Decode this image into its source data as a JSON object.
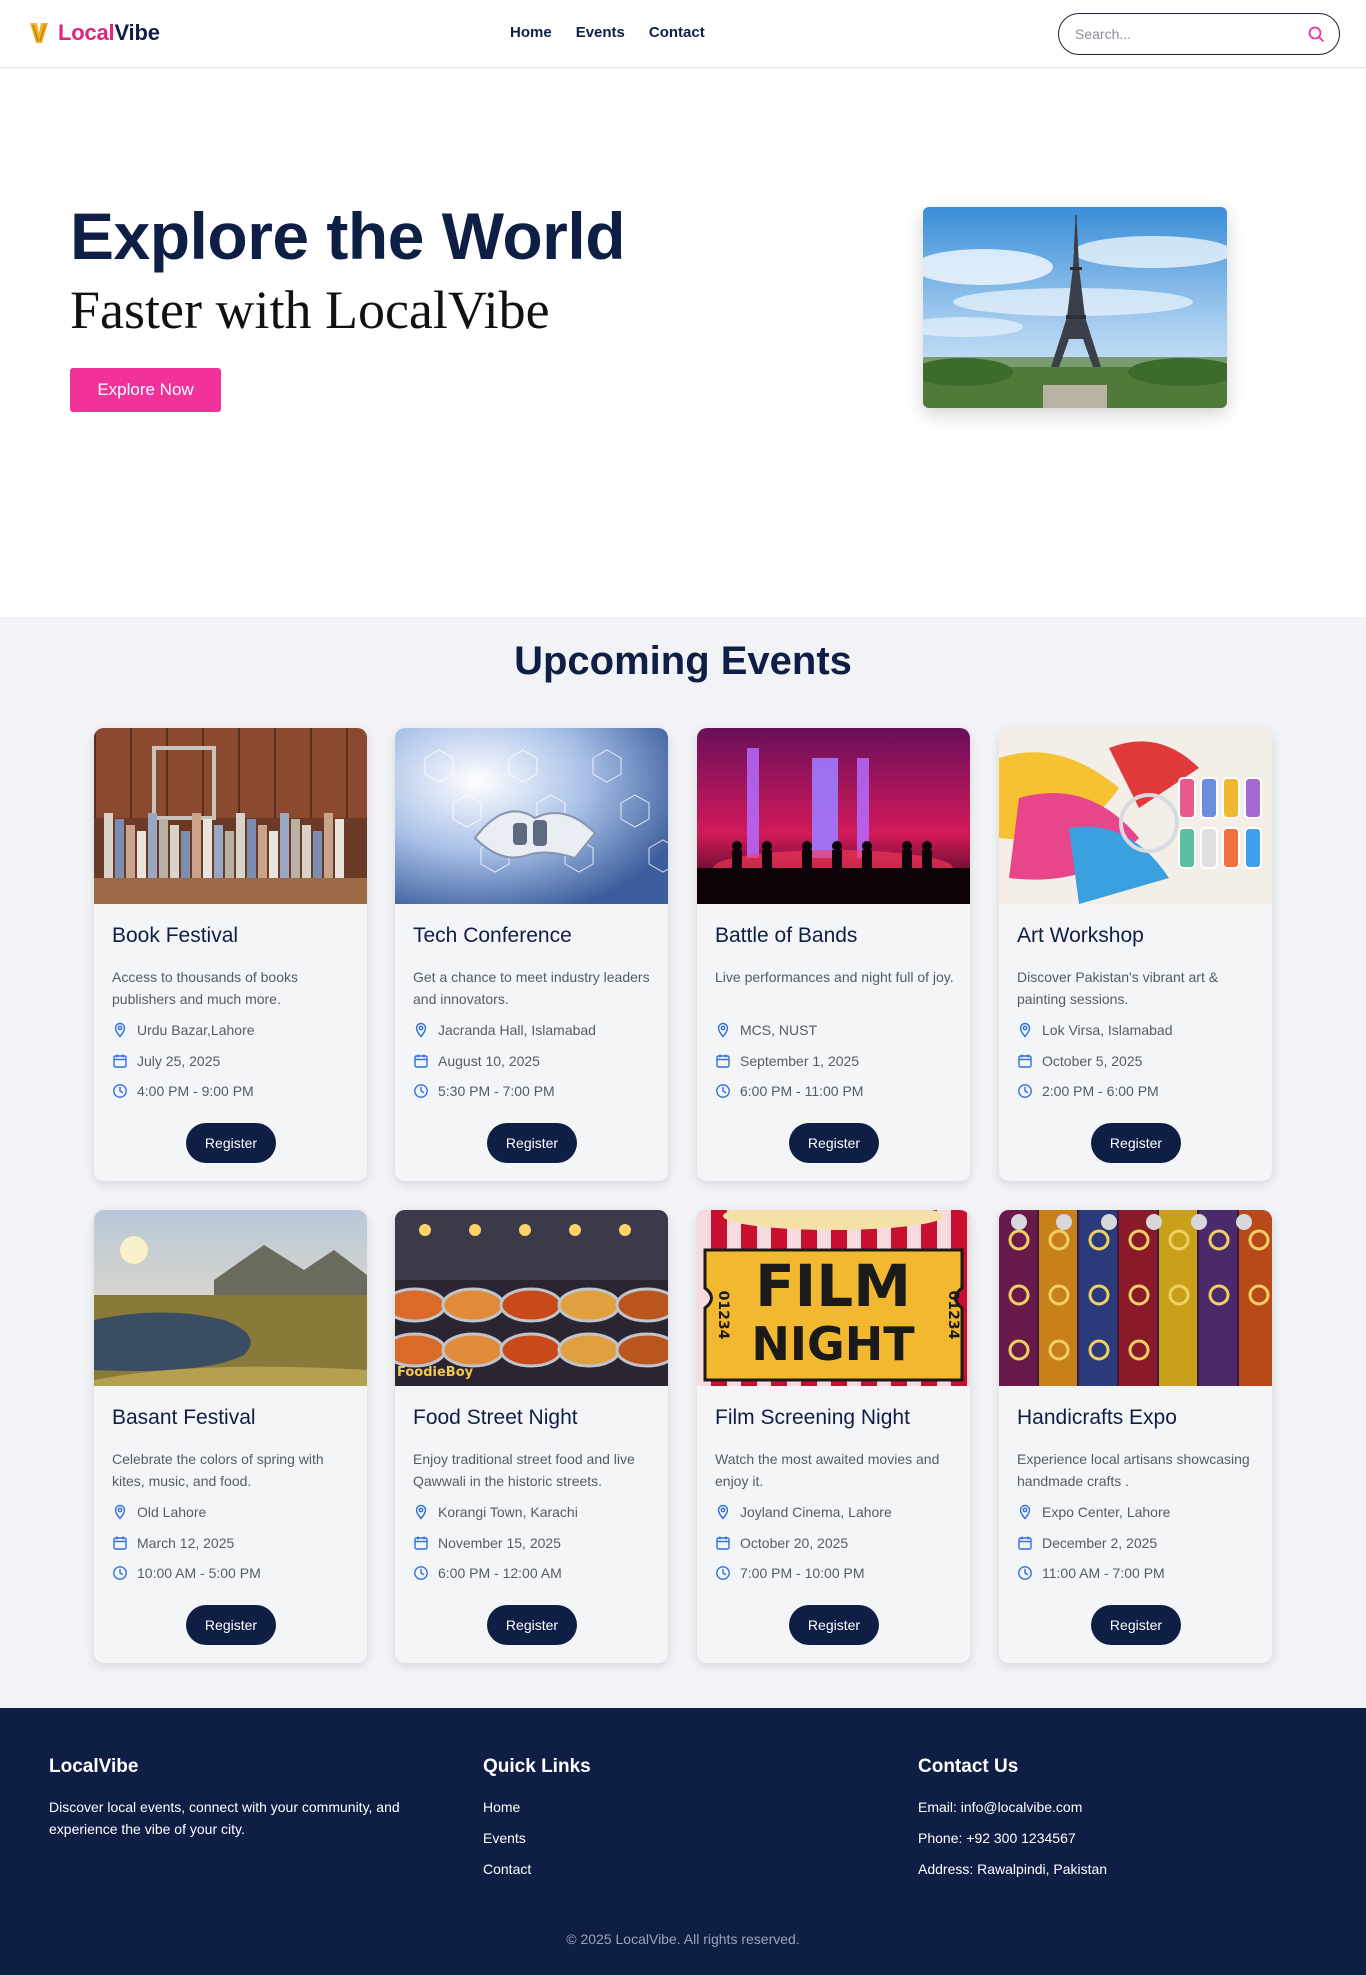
{
  "brand": {
    "local": "Local",
    "vibe": "Vibe"
  },
  "nav": {
    "home": "Home",
    "events": "Events",
    "contact": "Contact"
  },
  "search": {
    "placeholder": "Search..."
  },
  "hero": {
    "title": "Explore the World",
    "subtitle": "Faster with LocalVibe",
    "button": "Explore Now"
  },
  "events": {
    "heading": "Upcoming Events",
    "register_label": "Register",
    "cards": [
      {
        "title": "Book Festival",
        "desc": "Access to thousands of books publishers and much more.",
        "location": "Urdu Bazar,Lahore",
        "date": "July 25, 2025",
        "time": "4:00 PM - 9:00 PM",
        "image": "books"
      },
      {
        "title": "Tech Conference",
        "desc": "Get a chance to meet industry leaders and innovators.",
        "location": "Jacranda Hall, Islamabad",
        "date": "August 10, 2025",
        "time": "5:30 PM - 7:00 PM",
        "image": "robot-handshake"
      },
      {
        "title": "Battle of Bands",
        "desc": "Live performances and night full of joy.",
        "location": "MCS, NUST",
        "date": "September 1, 2025",
        "time": "6:00 PM - 11:00 PM",
        "image": "concert-stage"
      },
      {
        "title": "Art Workshop",
        "desc": "Discover Pakistan's vibrant art & painting sessions.",
        "location": "Lok Virsa, Islamabad",
        "date": "October 5, 2025",
        "time": "2:00 PM - 6:00 PM",
        "image": "paints"
      },
      {
        "title": "Basant Festival",
        "desc": "Celebrate the colors of spring with kites, music, and food.",
        "location": "Old Lahore",
        "date": "March 12, 2025",
        "time": "10:00 AM - 5:00 PM",
        "image": "landscape-river"
      },
      {
        "title": "Food Street Night",
        "desc": "Enjoy traditional street food and live Qawwali in the historic streets.",
        "location": "Korangi Town, Karachi",
        "date": "November 15, 2025",
        "time": "6:00 PM - 12:00 AM",
        "image": "food-market"
      },
      {
        "title": "Film Screening Night",
        "desc": "Watch the most awaited movies and enjoy it.",
        "location": "Joyland Cinema, Lahore",
        "date": "October 20, 2025",
        "time": "7:00 PM - 10:00 PM",
        "image": "film-ticket"
      },
      {
        "title": "Handicrafts Expo",
        "desc": "Experience local artisans showcasing handmade crafts .",
        "location": "Expo Center, Lahore",
        "date": "December 2, 2025",
        "time": "11:00 AM - 7:00 PM",
        "image": "embroidery"
      }
    ]
  },
  "footer": {
    "brand": "LocalVibe",
    "about": "Discover local events, connect with your community, and experience the vibe of your city.",
    "quick_links_heading": "Quick Links",
    "links": [
      "Home",
      "Events",
      "Contact"
    ],
    "contact_heading": "Contact Us",
    "email": "Email: info@localvibe.com",
    "phone": "Phone: +92 300 1234567",
    "address": "Address: Rawalpindi, Pakistan",
    "copyright": "© 2025 LocalVibe. All rights reserved."
  },
  "ticket_text": {
    "film": "FILM",
    "night": "NIGHT",
    "number": "01234",
    "brand_stamp": "FoodieBoy"
  },
  "colors": {
    "accent": "#f0329a",
    "brand_pink": "#e0267c",
    "navy": "#0f1e45",
    "icon_blue": "#2f6fe0"
  },
  "icons": {
    "location": "map-pin-icon",
    "date": "calendar-icon",
    "time": "clock-icon",
    "search": "search-icon"
  }
}
